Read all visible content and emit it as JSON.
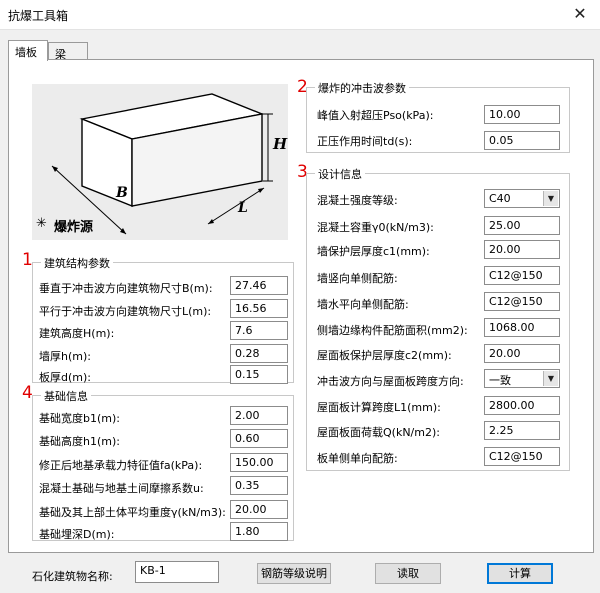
{
  "window": {
    "title": "抗爆工具箱",
    "close_glyph": "✕"
  },
  "tabs": [
    {
      "label": "墙板",
      "active": true
    },
    {
      "label": "梁",
      "active": false
    }
  ],
  "diagram": {
    "label_h": "H",
    "label_b": "B",
    "label_l": "L",
    "caption": "爆炸源",
    "star": "✳"
  },
  "groups": {
    "shockwave": {
      "index": "2",
      "title": "爆炸的冲击波参数",
      "fields": [
        {
          "label": "峰值入射超压Pso(kPa):",
          "value": "10.00"
        },
        {
          "label": "正压作用时间td(s):",
          "value": "0.05"
        }
      ]
    },
    "design": {
      "index": "3",
      "title": "设计信息",
      "fields": [
        {
          "label": "混凝土强度等级:",
          "value": "C40",
          "type": "combo"
        },
        {
          "label": "混凝土容重γ0(kN/m3):",
          "value": "25.00"
        },
        {
          "label": "墙保护层厚度c1(mm):",
          "value": "20.00"
        },
        {
          "label": "墙竖向单侧配筋:",
          "value": "C12@150"
        },
        {
          "label": "墙水平向单侧配筋:",
          "value": "C12@150"
        },
        {
          "label": "侧墙边缘构件配筋面积(mm2):",
          "value": "1068.00"
        },
        {
          "label": "屋面板保护层厚度c2(mm):",
          "value": "20.00"
        },
        {
          "label": "冲击波方向与屋面板跨度方向:",
          "value": "一致",
          "type": "combo"
        },
        {
          "label": "屋面板计算跨度L1(mm):",
          "value": "2800.00"
        },
        {
          "label": "屋面板面荷载Q(kN/m2):",
          "value": "2.25"
        },
        {
          "label": "板单侧单向配筋:",
          "value": "C12@150"
        }
      ]
    },
    "structure": {
      "index": "1",
      "title": "建筑结构参数",
      "fields": [
        {
          "label": "垂直于冲击波方向建筑物尺寸B(m):",
          "value": "27.46"
        },
        {
          "label": "平行于冲击波方向建筑物尺寸L(m):",
          "value": "16.56"
        },
        {
          "label": "建筑高度H(m):",
          "value": "7.6"
        },
        {
          "label": "墙厚h(m):",
          "value": "0.28"
        },
        {
          "label": "板厚d(m):",
          "value": "0.15"
        }
      ]
    },
    "foundation": {
      "index": "4",
      "title": "基础信息",
      "fields": [
        {
          "label": "基础宽度b1(m):",
          "value": "2.00"
        },
        {
          "label": "基础高度h1(m):",
          "value": "0.60"
        },
        {
          "label": "修正后地基承载力特征值fa(kPa):",
          "value": "150.00"
        },
        {
          "label": "混凝土基础与地基土间摩擦系数u:",
          "value": "0.35"
        },
        {
          "label": "基础及其上部土体平均重度γ(kN/m3):",
          "value": "20.00"
        },
        {
          "label": "基础埋深D(m):",
          "value": "1.80"
        }
      ]
    }
  },
  "bottom": {
    "name_label": "石化建筑物名称:",
    "name_value": "KB-1",
    "rebar_button": "钢筋等级说明",
    "read_button": "读取",
    "calc_button": "计算"
  }
}
